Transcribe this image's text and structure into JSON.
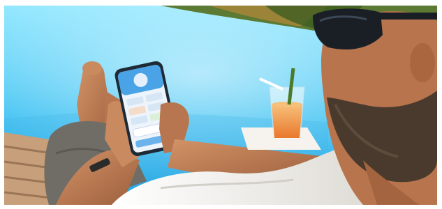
{
  "photo": {
    "subject": "person-using-smartphone-by-pool",
    "colors": {
      "pool_light": "#7ee0ff",
      "pool_deep": "#1ea7e8",
      "foliage": "#3f6b2a",
      "skin": "#b9774e",
      "shirt": "#f3f1ec",
      "shorts": "#6f6d66",
      "juice": "#f2a04a",
      "lounger": "#c9a27e",
      "phone_screen": "#eef4fb",
      "phone_accent": "#4aa3e6"
    }
  }
}
